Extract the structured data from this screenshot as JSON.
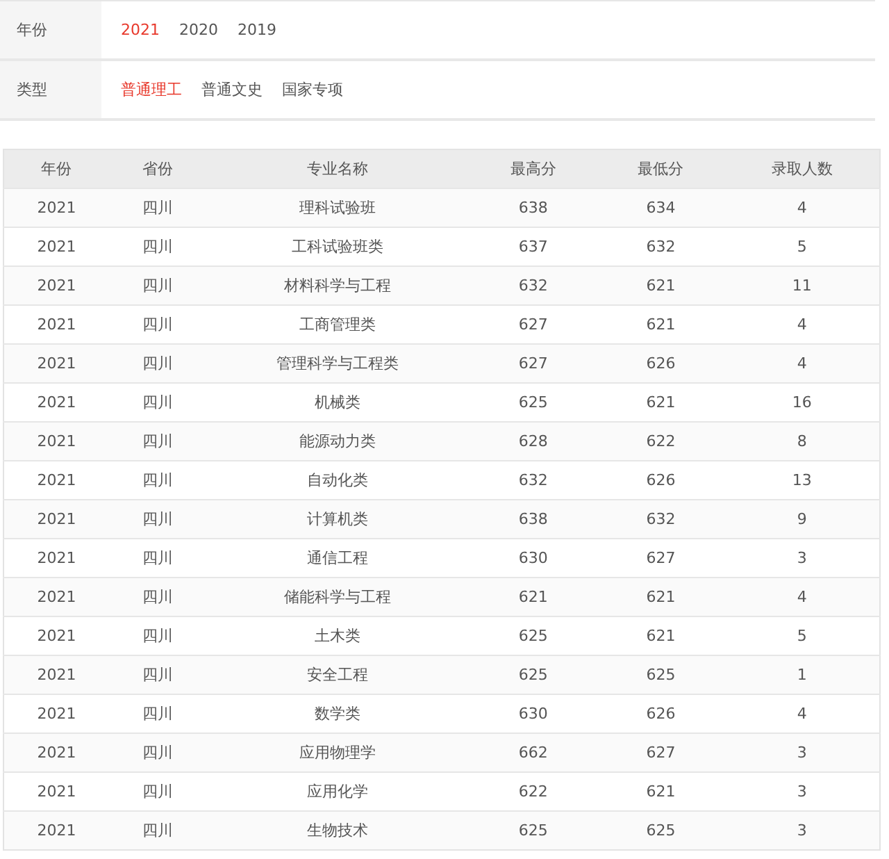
{
  "filters": [
    {
      "label": "年份",
      "options": [
        {
          "text": "2021",
          "selected": true
        },
        {
          "text": "2020",
          "selected": false
        },
        {
          "text": "2019",
          "selected": false
        }
      ]
    },
    {
      "label": "类型",
      "options": [
        {
          "text": "普通理工",
          "selected": true
        },
        {
          "text": "普通文史",
          "selected": false
        },
        {
          "text": "国家专项",
          "selected": false
        }
      ]
    }
  ],
  "table": {
    "columns": [
      "年份",
      "省份",
      "专业名称",
      "最高分",
      "最低分",
      "录取人数"
    ],
    "rows": [
      [
        "2021",
        "四川",
        "理科试验班",
        "638",
        "634",
        "4"
      ],
      [
        "2021",
        "四川",
        "工科试验班类",
        "637",
        "632",
        "5"
      ],
      [
        "2021",
        "四川",
        "材料科学与工程",
        "632",
        "621",
        "11"
      ],
      [
        "2021",
        "四川",
        "工商管理类",
        "627",
        "621",
        "4"
      ],
      [
        "2021",
        "四川",
        "管理科学与工程类",
        "627",
        "626",
        "4"
      ],
      [
        "2021",
        "四川",
        "机械类",
        "625",
        "621",
        "16"
      ],
      [
        "2021",
        "四川",
        "能源动力类",
        "628",
        "622",
        "8"
      ],
      [
        "2021",
        "四川",
        "自动化类",
        "632",
        "626",
        "13"
      ],
      [
        "2021",
        "四川",
        "计算机类",
        "638",
        "632",
        "9"
      ],
      [
        "2021",
        "四川",
        "通信工程",
        "630",
        "627",
        "3"
      ],
      [
        "2021",
        "四川",
        "储能科学与工程",
        "621",
        "621",
        "4"
      ],
      [
        "2021",
        "四川",
        "土木类",
        "625",
        "621",
        "5"
      ],
      [
        "2021",
        "四川",
        "安全工程",
        "625",
        "625",
        "1"
      ],
      [
        "2021",
        "四川",
        "数学类",
        "630",
        "626",
        "4"
      ],
      [
        "2021",
        "四川",
        "应用物理学",
        "662",
        "627",
        "3"
      ],
      [
        "2021",
        "四川",
        "应用化学",
        "622",
        "621",
        "3"
      ],
      [
        "2021",
        "四川",
        "生物技术",
        "625",
        "625",
        "3"
      ]
    ]
  }
}
